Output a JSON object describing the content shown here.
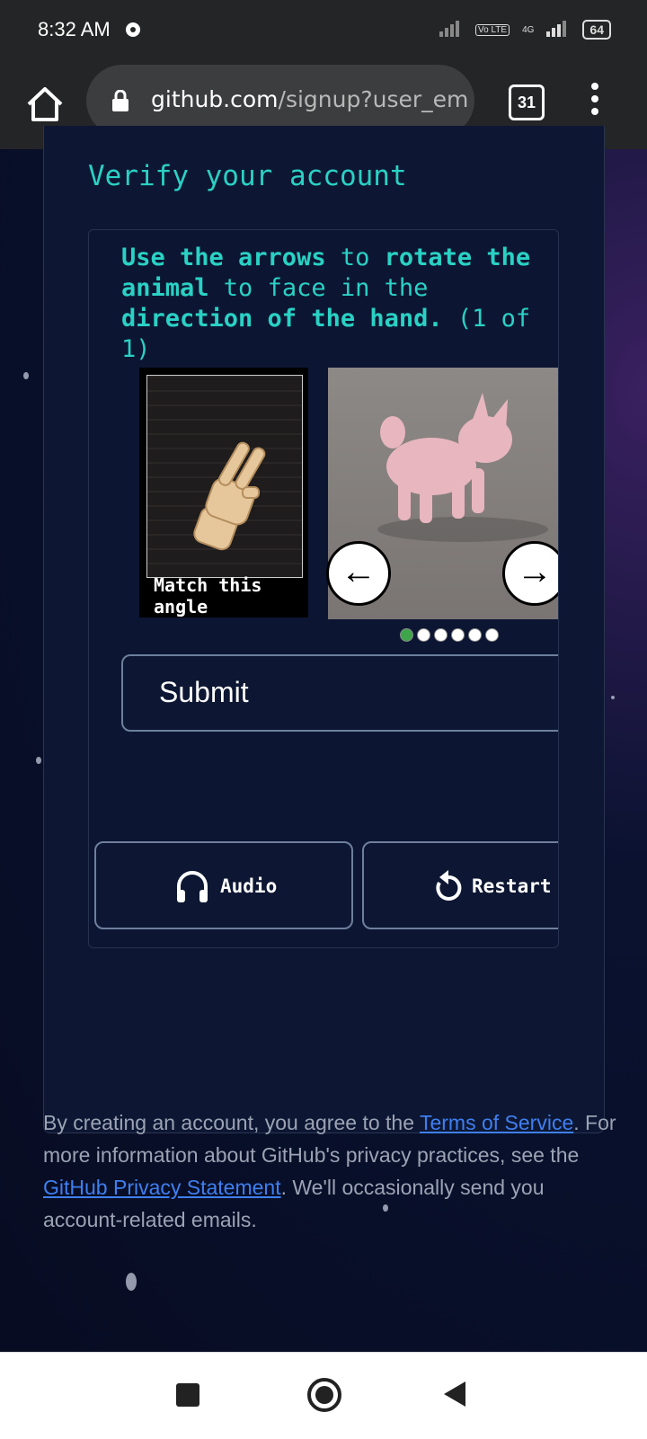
{
  "status_bar": {
    "time": "8:32 AM",
    "network": "4G",
    "volte": "Vo LTE",
    "battery": "64"
  },
  "browser": {
    "url_domain": "github.com",
    "url_path": "/signup?user_em",
    "tab_count": "31"
  },
  "verify": {
    "title": "Verify your account",
    "instruction_part1": "Use the arrows",
    "instruction_part2": " to ",
    "instruction_part3": "rotate the animal",
    "instruction_part4": " to face in the ",
    "instruction_part5": "direction of the hand.",
    "instruction_part6": " (1 of 1)",
    "hand_caption": "Match this angle",
    "left_arrow": "←",
    "right_arrow": "→",
    "page_dots": {
      "total": 6,
      "active": 1
    },
    "submit_label": "Submit",
    "audio_label": "Audio",
    "restart_label": "Restart"
  },
  "legal": {
    "text1": "By creating an account, you agree to the ",
    "terms_link": "Terms of Service",
    "text2": ". For more information about GitHub's privacy practices, see the ",
    "privacy_link": "GitHub Privacy Statement",
    "text3": ". We'll occasionally send you account-related emails."
  },
  "colors": {
    "accent_teal": "#2ad1c4",
    "link_blue": "#3f7ff0",
    "active_dot": "#3fa54a"
  }
}
